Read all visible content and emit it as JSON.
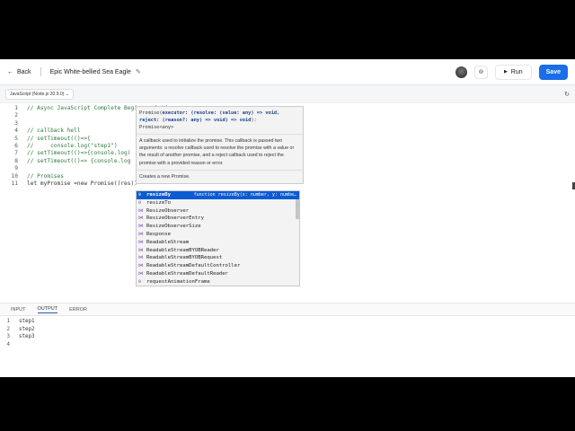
{
  "header": {
    "back_label": "Back",
    "title": "Epic White-bellied Sea Eagle",
    "run_label": "Run",
    "save_label": "Save"
  },
  "toolbar": {
    "language": "JavaScript (Node.js 20.9.0)"
  },
  "editor": {
    "lines": [
      {
        "n": "1",
        "text": "// Async JavaScript Complete Beginner Guide",
        "type": "cm"
      },
      {
        "n": "2",
        "text": "",
        "type": "code"
      },
      {
        "n": "3",
        "text": "",
        "type": "code"
      },
      {
        "n": "4",
        "text": "// callback hell",
        "type": "cm"
      },
      {
        "n": "5",
        "text": "// setTimeout(()=>{",
        "type": "cm"
      },
      {
        "n": "6",
        "text": "//     console.log(\"step1\")",
        "type": "cm"
      },
      {
        "n": "7",
        "text": "// setTimeout(()=>{console.log(",
        "type": "cm"
      },
      {
        "n": "8",
        "text": "// setTimeout(()=> {console.log",
        "type": "cm"
      },
      {
        "n": "9",
        "text": "",
        "type": "code"
      },
      {
        "n": "10",
        "text": "// Promises",
        "type": "cm"
      },
      {
        "n": "11",
        "text": "let myPromise =new Promise((res))",
        "type": "code"
      }
    ]
  },
  "tooltip": {
    "signature_name": "Promise(",
    "signature_params": "executor: (resolve: (value: any) => void, reject: (reason?: any) => void) => void",
    "signature_end": "):",
    "return_type": "Promise<any>",
    "doc": "A callback used to initialize the promise. This callback is passed two arguments: a resolve callback used to resolve the promise with a value or the result of another promise, and a reject callback used to reject the promise with a provided reason or error.",
    "summary": "Creates a new Promise."
  },
  "suggestions": [
    {
      "label": "resizeBy",
      "kind": "method",
      "detail": "function resizeBy(x: number, y: numbe…"
    },
    {
      "label": "resizeTo",
      "kind": "method"
    },
    {
      "label": "ResizeObserver",
      "kind": "variable"
    },
    {
      "label": "ResizeObserverEntry",
      "kind": "variable"
    },
    {
      "label": "ResizeObserverSize",
      "kind": "variable"
    },
    {
      "label": "Response",
      "kind": "variable"
    },
    {
      "label": "ReadableStream",
      "kind": "variable"
    },
    {
      "label": "ReadableStreamBYOBReader",
      "kind": "variable"
    },
    {
      "label": "ReadableStreamBYOBRequest",
      "kind": "variable"
    },
    {
      "label": "ReadableStreamDefaultController",
      "kind": "variable"
    },
    {
      "label": "ReadableStreamDefaultReader",
      "kind": "variable"
    },
    {
      "label": "requestAnimationFrame",
      "kind": "method"
    }
  ],
  "tabs": [
    "INPUT",
    "OUTPUT",
    "ERROR"
  ],
  "active_tab": "OUTPUT",
  "output": [
    {
      "n": "1",
      "text": "step1"
    },
    {
      "n": "2",
      "text": "step2"
    },
    {
      "n": "3",
      "text": "step3"
    },
    {
      "n": "4",
      "text": ""
    }
  ]
}
